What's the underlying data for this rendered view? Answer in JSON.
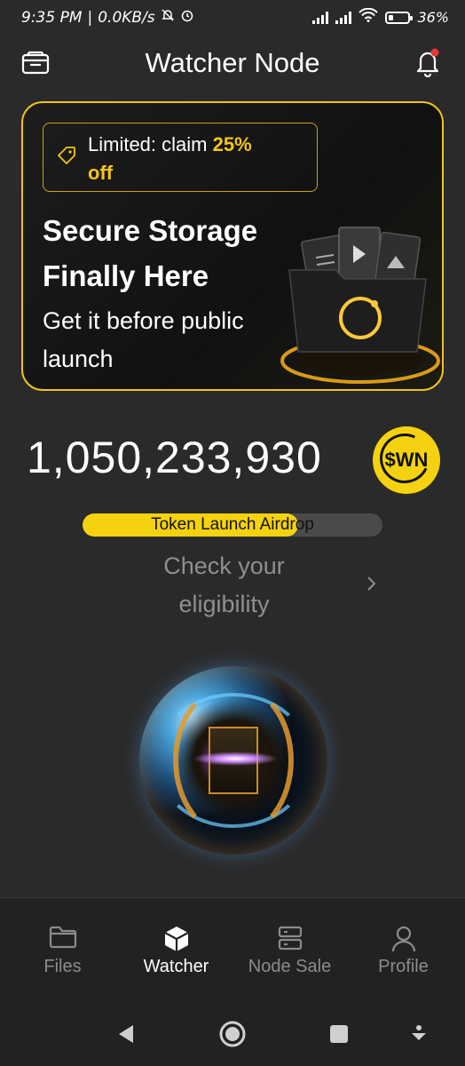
{
  "status_bar": {
    "time": "9:35 PM",
    "speed": "0.0KB/s",
    "battery": "36%",
    "battery_level": 0.36
  },
  "header": {
    "title": "Watcher Node"
  },
  "promo": {
    "badge_prefix": "Limited: claim ",
    "badge_highlight": "25%",
    "badge_suffix": "off",
    "title": "Secure Storage Finally Here",
    "subtitle": "Get it before public launch",
    "accent": "#f5c518"
  },
  "balance": {
    "value": "1,050,233,930",
    "token": "$WN"
  },
  "airdrop": {
    "label": "Token Launch Airdrop",
    "progress": 0.72
  },
  "eligibility": {
    "text": "Check your eligibility"
  },
  "bottom_nav": {
    "items": [
      {
        "label": "Files",
        "icon": "folder-icon",
        "active": false
      },
      {
        "label": "Watcher",
        "icon": "cube-icon",
        "active": true
      },
      {
        "label": "Node Sale",
        "icon": "server-icon",
        "active": false
      },
      {
        "label": "Profile",
        "icon": "user-icon",
        "active": false
      }
    ]
  },
  "colors": {
    "background": "#2a2a2a",
    "accent_yellow": "#f5d20f",
    "muted_text": "#8f8f8f"
  }
}
